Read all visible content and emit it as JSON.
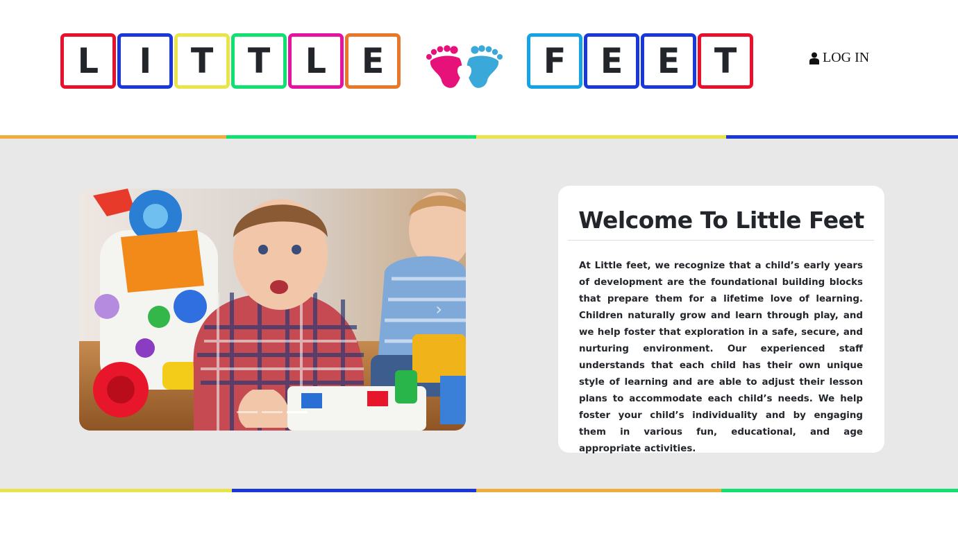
{
  "header": {
    "logo_word1": [
      "L",
      "I",
      "T",
      "T",
      "L",
      "E"
    ],
    "logo_word2": [
      "F",
      "E",
      "E",
      "T"
    ],
    "logo_colors_word1": [
      "#e8102a",
      "#1a38d9",
      "#e8e44a",
      "#10e06f",
      "#e612a0",
      "#e9772a"
    ],
    "logo_colors_word2": [
      "#14a3e4",
      "#1a38d9",
      "#1a38d9",
      "#e8102a"
    ],
    "feet_icon": "baby-feet-heart-icon",
    "login_icon": "user-icon",
    "login_label": "LOG IN"
  },
  "stripes": {
    "top": [
      "#f0ac3c",
      "#10e06f",
      "#e8e44a",
      "#1a38d9"
    ],
    "bottom": [
      "#e8e44a",
      "#1a38d9",
      "#f0ac3c",
      "#10e06f"
    ]
  },
  "carousel": {
    "image": "children-playing-with-toys-photo",
    "next_icon": "chevron-right-icon",
    "slide_count": 3,
    "active_slide": 3
  },
  "welcome": {
    "title": "Welcome To Little Feet",
    "body": "At Little feet, we recognize that a child’s early years of development are the foundational building blocks that prepare them for a lifetime love of learning. Children naturally grow and learn through play, and we help foster that exploration in a safe, secure, and nurturing environment. Our experienced staff understands that each child has their own unique style of learning and are able to adjust their lesson plans to accommodate each child’s needs. We help foster your child’s individuality and by engaging them in various fun, educational, and age appropriate activities."
  }
}
